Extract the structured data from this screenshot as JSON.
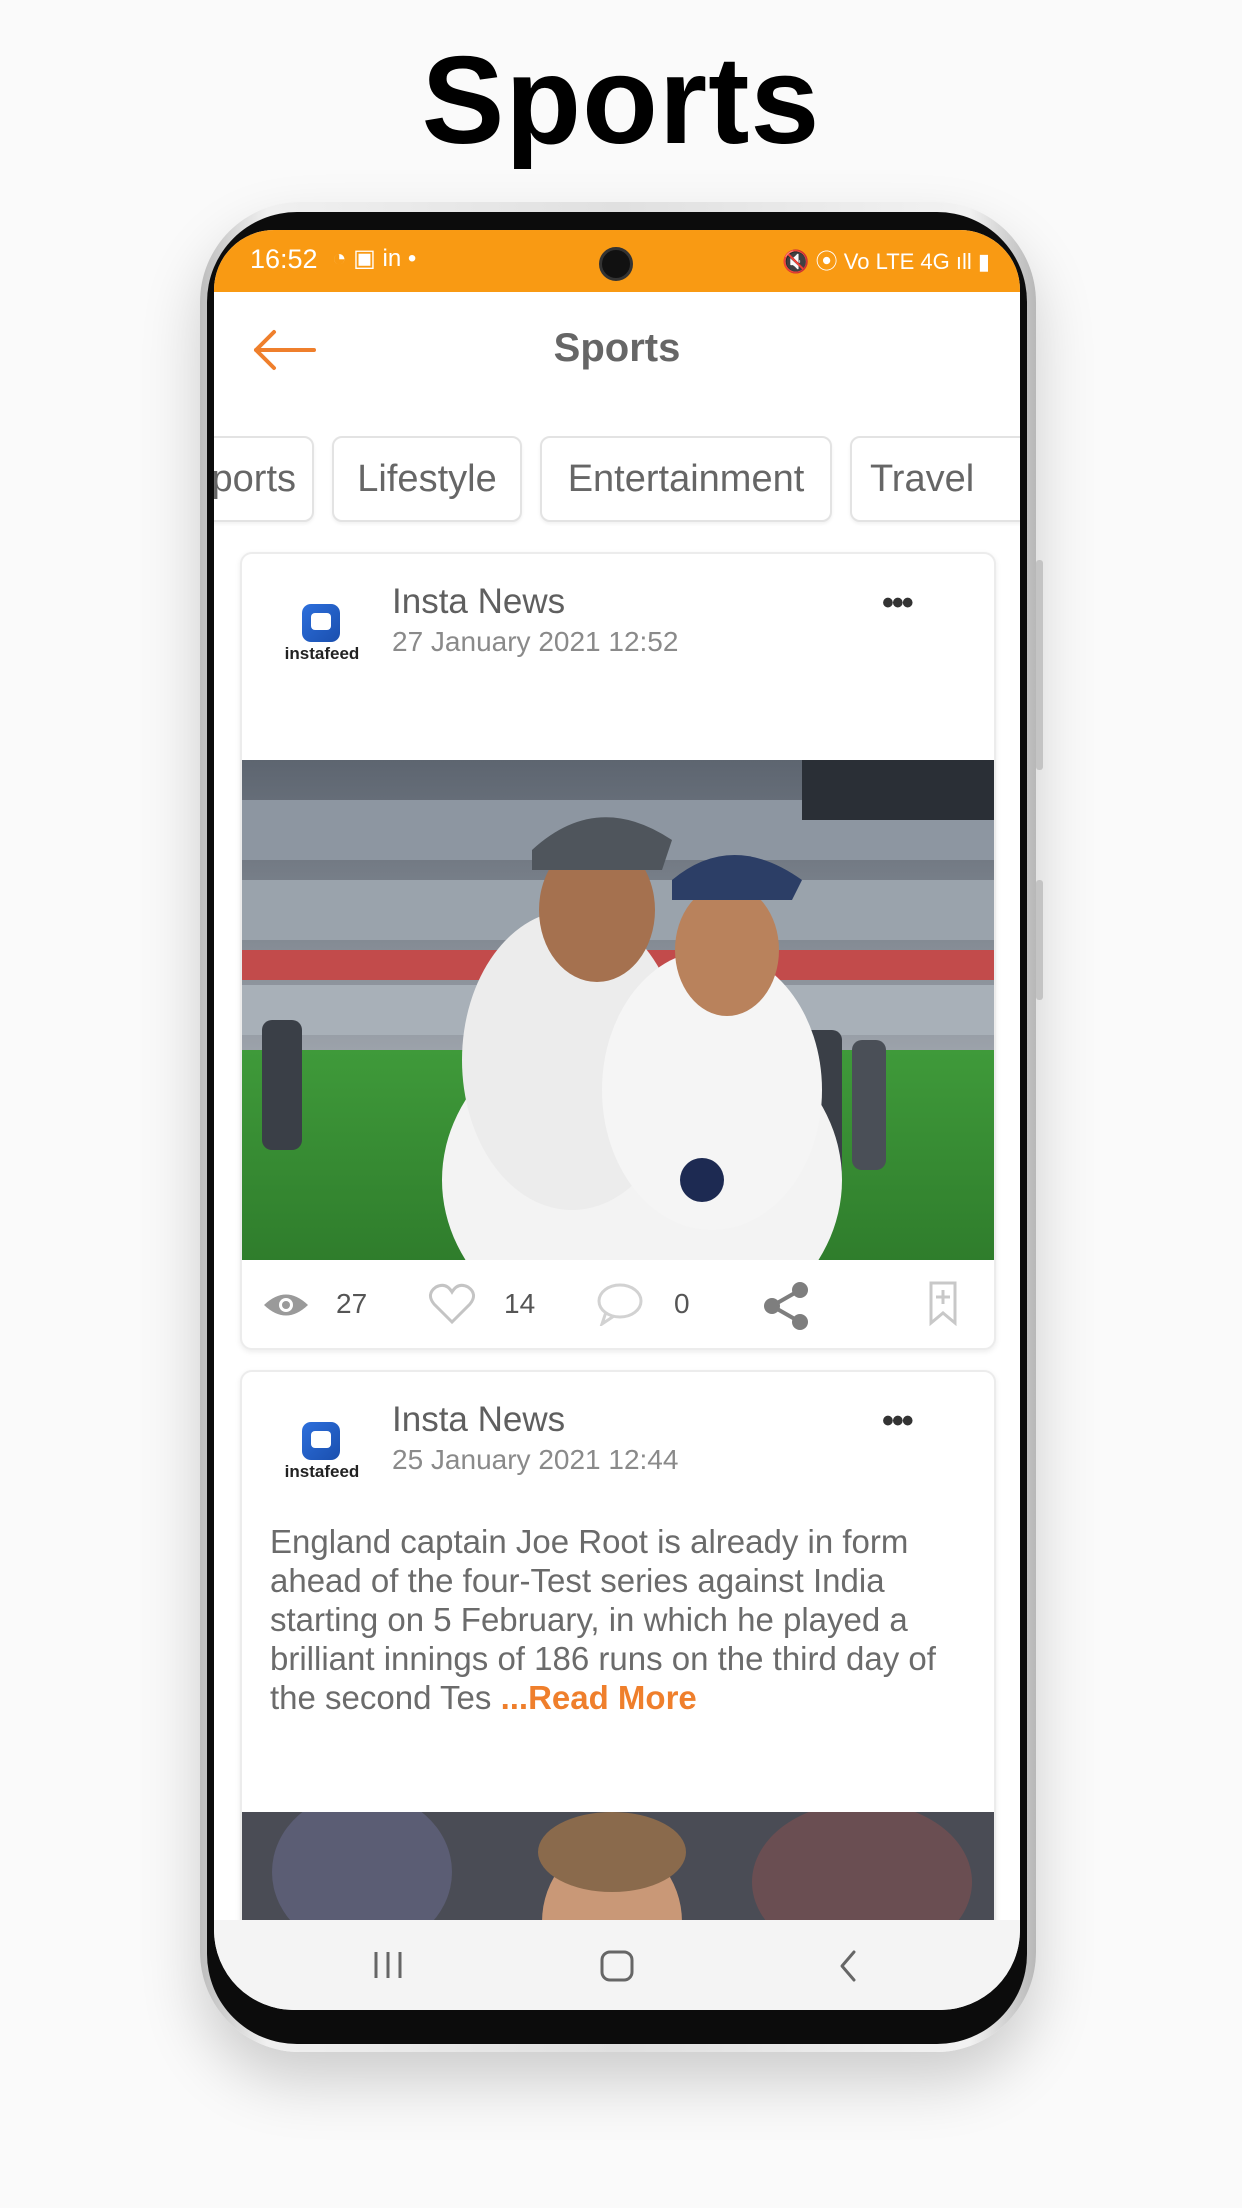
{
  "promo": {
    "title": "Sports"
  },
  "status_bar": {
    "time": "16:52",
    "left_icons": "◔ ▣ in •",
    "right_icons": "🔇 ⦿ Vo LTE 4G ıll ▮"
  },
  "app_bar": {
    "title": "Sports"
  },
  "colors": {
    "accent": "#f99a13",
    "link": "#ef7f2c"
  },
  "categories": [
    "Sports",
    "Lifestyle",
    "Entertainment",
    "Travel"
  ],
  "posts": [
    {
      "logo_text": "instafeed",
      "source": "Insta News",
      "date": "27 January 2021 12:52",
      "views": "27",
      "likes": "14",
      "comments": "0"
    },
    {
      "logo_text": "instafeed",
      "source": "Insta News",
      "date": "25 January 2021 12:44",
      "excerpt": "England captain Joe Root is already in form ahead of the four-Test series against India starting on 5 February, in which he played a brilliant innings of 186 runs on the third day of the second Tes",
      "read_more": "...Read More"
    }
  ]
}
